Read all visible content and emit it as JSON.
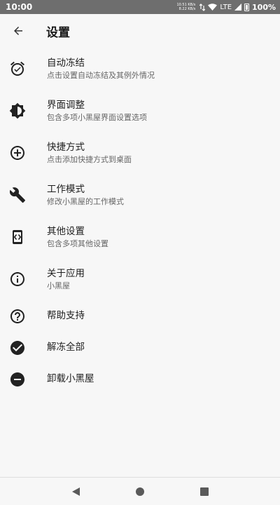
{
  "status_bar": {
    "time": "10:00",
    "upload_speed": "10.51 KB/s",
    "download_speed": "8.22 KB/s",
    "network": "LTE",
    "battery": "100%"
  },
  "app_bar": {
    "title": "设置"
  },
  "menu": [
    {
      "title": "自动冻结",
      "subtitle": "点击设置自动冻结及其例外情况",
      "icon": "alarm-icon"
    },
    {
      "title": "界面调整",
      "subtitle": "包含多项小黑屋界面设置选项",
      "icon": "brightness-icon"
    },
    {
      "title": "快捷方式",
      "subtitle": "点击添加快捷方式到桌面",
      "icon": "add-circle-icon"
    },
    {
      "title": "工作模式",
      "subtitle": "修改小黑屋的工作模式",
      "icon": "wrench-icon"
    },
    {
      "title": "其他设置",
      "subtitle": "包含多项其他设置",
      "icon": "settings-code-icon"
    },
    {
      "title": "关于应用",
      "subtitle": "小黑屋",
      "icon": "info-icon"
    },
    {
      "title": "帮助支持",
      "icon": "help-icon"
    },
    {
      "title": "解冻全部",
      "icon": "check-circle-icon"
    },
    {
      "title": "卸载小黑屋",
      "icon": "remove-circle-icon"
    }
  ]
}
